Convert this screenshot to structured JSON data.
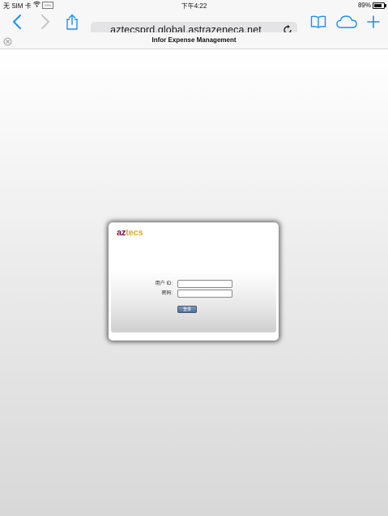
{
  "status_bar": {
    "carrier": "无 SIM 卡",
    "sync_icon_text": "VPN",
    "time": "下午4:22",
    "battery": "89%"
  },
  "toolbar": {
    "url": "aztecsprd.global.astrazeneca.net",
    "accent_color": "#1f8cf5"
  },
  "tab": {
    "title": "Infor Expense Management"
  },
  "login": {
    "logo_part1": "az",
    "logo_part2": "tecs",
    "user_label": "用户 ID:",
    "password_label": "密码:",
    "user_value": "",
    "password_value": "",
    "button_label": "登录"
  }
}
